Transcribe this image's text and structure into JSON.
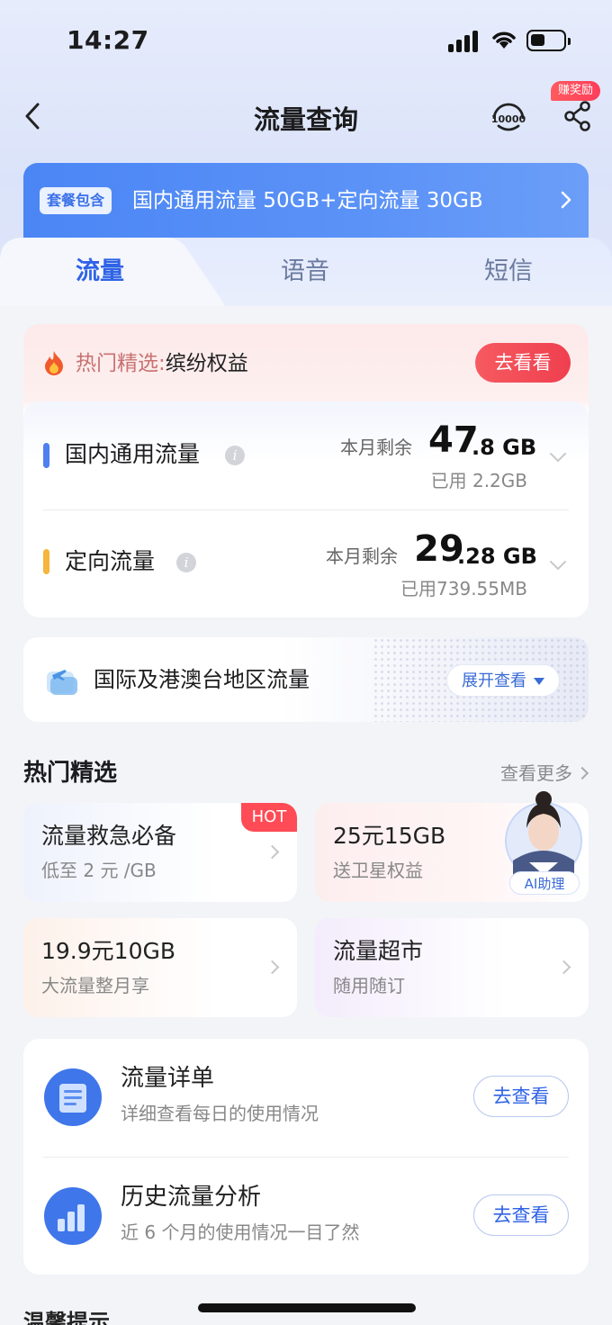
{
  "status_bar": {
    "time": "14:27"
  },
  "nav": {
    "title": "流量查询",
    "reward_badge": "赚奖励",
    "service_icon_text": "10000"
  },
  "package": {
    "tag": "套餐包含",
    "text": "国内通用流量 50GB+定向流量 30GB"
  },
  "tabs": [
    {
      "label": "流量",
      "active": true
    },
    {
      "label": "语音",
      "active": false
    },
    {
      "label": "短信",
      "active": false
    }
  ],
  "hot_strip": {
    "prefix": "热门精选:",
    "text": "缤纷权益",
    "button": "去看看"
  },
  "usage": [
    {
      "name": "国内通用流量",
      "remain_label": "本月剩余",
      "remain_int": "47",
      "remain_dec": ".8 GB",
      "used": "已用 2.2GB",
      "bar_color": "#4f7ff0"
    },
    {
      "name": "定向流量",
      "remain_label": "本月剩余",
      "remain_int": "29",
      "remain_dec": ".28 GB",
      "used": "已用739.55MB",
      "bar_color": "#f6b53c"
    }
  ],
  "intl": {
    "text": "国际及港澳台地区流量",
    "button": "展开查看"
  },
  "hot_section": {
    "title": "热门精选",
    "more": "查看更多",
    "cards": [
      {
        "title": "流量救急必备",
        "sub": "低至 2 元 /GB",
        "tag": "HOT"
      },
      {
        "title": "25元15GB",
        "sub": "送卫星权益"
      },
      {
        "title": "19.9元10GB",
        "sub": "大流量整月享"
      },
      {
        "title": "流量超市",
        "sub": "随用随订"
      }
    ],
    "ai_label": "AI助理"
  },
  "details": [
    {
      "title": "流量详单",
      "sub": "详细查看每日的使用情况",
      "button": "去查看"
    },
    {
      "title": "历史流量分析",
      "sub": "近 6 个月的使用情况一目了然",
      "button": "去查看"
    }
  ],
  "tips_title": "温馨提示"
}
